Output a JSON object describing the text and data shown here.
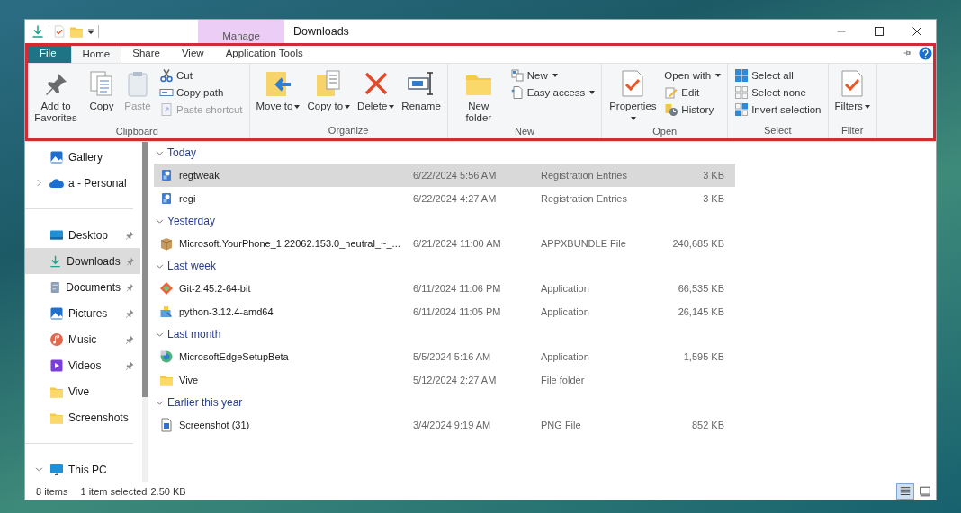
{
  "window": {
    "title": "Downloads",
    "context_tab": "Manage"
  },
  "ribbon": {
    "tabs": [
      {
        "label": "File",
        "kind": "file",
        "selected": false
      },
      {
        "label": "Home",
        "kind": "tab",
        "selected": true
      },
      {
        "label": "Share",
        "kind": "tab",
        "selected": false
      },
      {
        "label": "View",
        "kind": "tab",
        "selected": false
      },
      {
        "label": "Application Tools",
        "kind": "tab",
        "selected": false
      }
    ],
    "groups": [
      {
        "label": "Clipboard",
        "items": [
          {
            "kind": "large",
            "label": "Add to Favorites",
            "dropdown": false,
            "disabled": false
          },
          {
            "kind": "large",
            "label": "Copy",
            "dropdown": false,
            "disabled": false
          },
          {
            "kind": "large",
            "label": "Paste",
            "dropdown": false,
            "disabled": true
          },
          {
            "kind": "stack",
            "items": [
              {
                "label": "Cut",
                "dropdown": false,
                "disabled": false
              },
              {
                "label": "Copy path",
                "dropdown": false,
                "disabled": false
              },
              {
                "label": "Paste shortcut",
                "dropdown": false,
                "disabled": true
              }
            ]
          }
        ]
      },
      {
        "label": "Organize",
        "items": [
          {
            "kind": "large",
            "label": "Move to",
            "dropdown": true,
            "disabled": false
          },
          {
            "kind": "large",
            "label": "Copy to",
            "dropdown": true,
            "disabled": false
          },
          {
            "kind": "large",
            "label": "Delete",
            "dropdown": true,
            "disabled": false
          },
          {
            "kind": "large",
            "label": "Rename",
            "dropdown": false,
            "disabled": false
          }
        ]
      },
      {
        "label": "New",
        "items": [
          {
            "kind": "large",
            "label": "New folder",
            "dropdown": false,
            "disabled": false
          },
          {
            "kind": "stack",
            "items": [
              {
                "label": "New",
                "dropdown": true,
                "disabled": false
              },
              {
                "label": "Easy access",
                "dropdown": true,
                "disabled": false
              }
            ]
          }
        ]
      },
      {
        "label": "Open",
        "items": [
          {
            "kind": "large",
            "label": "Properties",
            "dropdown": true,
            "disabled": false
          },
          {
            "kind": "stack",
            "items": [
              {
                "label": "Open with",
                "dropdown": true,
                "disabled": false
              },
              {
                "label": "Edit",
                "dropdown": false,
                "disabled": false
              },
              {
                "label": "History",
                "dropdown": false,
                "disabled": false
              }
            ]
          }
        ]
      },
      {
        "label": "Select",
        "items": [
          {
            "kind": "stack",
            "items": [
              {
                "label": "Select all",
                "dropdown": false,
                "disabled": false
              },
              {
                "label": "Select none",
                "dropdown": false,
                "disabled": false
              },
              {
                "label": "Invert selection",
                "dropdown": false,
                "disabled": false
              }
            ]
          }
        ]
      },
      {
        "label": "Filter",
        "items": [
          {
            "kind": "large",
            "label": "Filters",
            "dropdown": true,
            "disabled": false
          }
        ]
      }
    ]
  },
  "sidebar": {
    "items": [
      {
        "kind": "item",
        "label": "Gallery",
        "pinned": false,
        "selected": false
      },
      {
        "kind": "item",
        "label": "a - Personal",
        "pinned": false,
        "selected": false,
        "expanded": false
      },
      {
        "kind": "divider"
      },
      {
        "kind": "item",
        "label": "Desktop",
        "pinned": true,
        "selected": false
      },
      {
        "kind": "item",
        "label": "Downloads",
        "pinned": true,
        "selected": true
      },
      {
        "kind": "item",
        "label": "Documents",
        "pinned": true,
        "selected": false
      },
      {
        "kind": "item",
        "label": "Pictures",
        "pinned": true,
        "selected": false
      },
      {
        "kind": "item",
        "label": "Music",
        "pinned": true,
        "selected": false
      },
      {
        "kind": "item",
        "label": "Videos",
        "pinned": true,
        "selected": false
      },
      {
        "kind": "item",
        "label": "Vive",
        "pinned": false,
        "selected": false
      },
      {
        "kind": "item",
        "label": "Screenshots",
        "pinned": false,
        "selected": false
      },
      {
        "kind": "divider"
      },
      {
        "kind": "item",
        "label": "This PC",
        "pinned": false,
        "selected": false,
        "expanded": true
      }
    ]
  },
  "file_list": {
    "groups": [
      {
        "label": "Today",
        "expanded": true,
        "rows": [
          {
            "name": "regtweak",
            "date": "6/22/2024 5:56 AM",
            "type": "Registration Entries",
            "size": "3 KB",
            "selected": true
          },
          {
            "name": "regi",
            "date": "6/22/2024 4:27 AM",
            "type": "Registration Entries",
            "size": "3 KB",
            "selected": false
          }
        ]
      },
      {
        "label": "Yesterday",
        "expanded": true,
        "rows": [
          {
            "name": "Microsoft.YourPhone_1.22062.153.0_neutral_~_...",
            "date": "6/21/2024 11:00 AM",
            "type": "APPXBUNDLE File",
            "size": "240,685 KB",
            "selected": false
          }
        ]
      },
      {
        "label": "Last week",
        "expanded": true,
        "rows": [
          {
            "name": "Git-2.45.2-64-bit",
            "date": "6/11/2024 11:06 PM",
            "type": "Application",
            "size": "66,535 KB",
            "selected": false
          },
          {
            "name": "python-3.12.4-amd64",
            "date": "6/11/2024 11:05 PM",
            "type": "Application",
            "size": "26,145 KB",
            "selected": false
          }
        ]
      },
      {
        "label": "Last month",
        "expanded": true,
        "rows": [
          {
            "name": "MicrosoftEdgeSetupBeta",
            "date": "5/5/2024 5:16 AM",
            "type": "Application",
            "size": "1,595 KB",
            "selected": false
          },
          {
            "name": "Vive",
            "date": "5/12/2024 2:27 AM",
            "type": "File folder",
            "selected": false
          }
        ]
      },
      {
        "label": "Earlier this year",
        "expanded": true,
        "rows": [
          {
            "name": "Screenshot (31)",
            "date": "3/4/2024 9:19 AM",
            "type": "PNG File",
            "size": "852 KB",
            "selected": false
          }
        ]
      }
    ]
  },
  "status_bar": {
    "item_count": "8 items",
    "selection": "1 item selected",
    "selection_size": "2.50 KB",
    "views": [
      {
        "kind": "details",
        "selected": true
      },
      {
        "kind": "large_icons",
        "selected": false
      }
    ]
  }
}
